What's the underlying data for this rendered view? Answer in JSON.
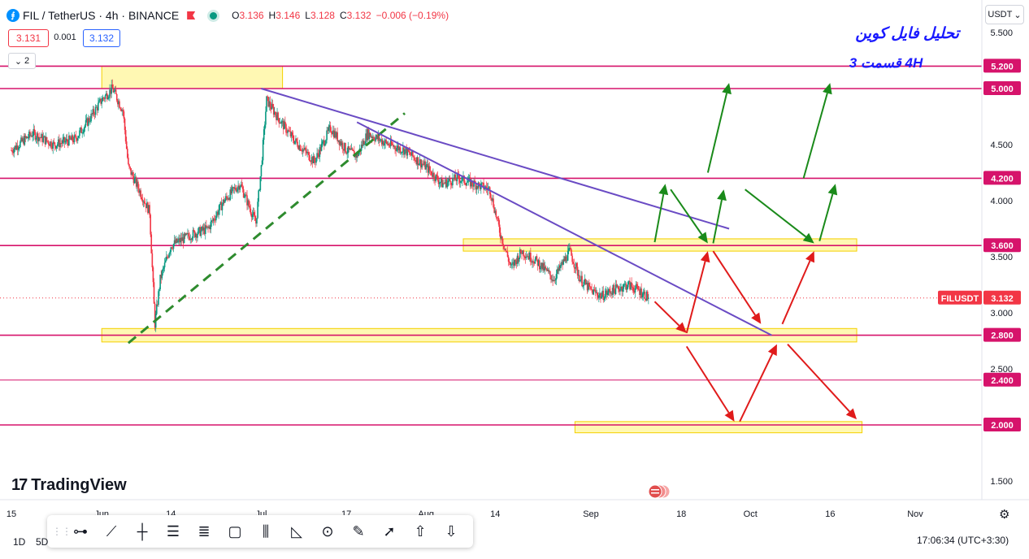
{
  "header": {
    "logo_icon": "filecoin-logo-icon",
    "symbol_text": "FIL / TetherUS · 4h · BINANCE",
    "ohlc": [
      {
        "k": "O",
        "v": "3.136"
      },
      {
        "k": "H",
        "v": "3.146"
      },
      {
        "k": "L",
        "v": "3.128"
      },
      {
        "k": "C",
        "v": "3.132"
      },
      {
        "k": "",
        "v": "−0.006 (−0.19%)"
      }
    ]
  },
  "trade": {
    "sell": "3.131",
    "spread": "0.001",
    "buy": "3.132"
  },
  "indicators_collapsed": "2",
  "currency_selector": "USDT",
  "annotation": {
    "title": "تحلیل فایل کوین",
    "subtitle": "4H    قسمت 3"
  },
  "brand": {
    "name": "TradingView"
  },
  "toolbar": {
    "tools": [
      "horizontal-ray-icon",
      "trend-line-icon",
      "vertical-line-icon",
      "parallel-channel-icon",
      "fib-retracement-icon",
      "rectangle-icon",
      "gann-fan-icon",
      "triangle-pattern-icon",
      "circle-icon",
      "brush-icon",
      "arrow-marker-icon",
      "arrow-up-icon",
      "arrow-down-icon"
    ]
  },
  "footer": {
    "tf1": "1D",
    "tf2": "5D",
    "time": "17:06:34",
    "tz": "(UTC+3:30)"
  },
  "chart_data": {
    "type": "candlestick",
    "pair": "FIL/USDT",
    "timeframe": "4h",
    "y_scale": "linear",
    "ylim": [
      1.3,
      5.65
    ],
    "y_ticks": [
      "5.500",
      "4.500",
      "4.000",
      "3.500",
      "3.000",
      "2.500",
      "1.500"
    ],
    "x_ticks": [
      "15",
      "Jun",
      "14",
      "Jul",
      "17",
      "Aug",
      "14",
      "Sep",
      "18",
      "Oct",
      "16",
      "Nov"
    ],
    "x_dates": [
      "2023-05-15",
      "2023-06-01",
      "2023-06-14",
      "2023-07-01",
      "2023-07-17",
      "2023-08-01",
      "2023-08-14",
      "2023-09-01",
      "2023-09-18",
      "2023-10-01",
      "2023-10-16",
      "2023-11-01"
    ],
    "last_price": {
      "label": "FILUSDT",
      "value": "3.132"
    },
    "horizontal_levels": [
      {
        "label": "5.200",
        "value": 5.2
      },
      {
        "label": "5.000",
        "value": 5.0
      },
      {
        "label": "4.200",
        "value": 4.2
      },
      {
        "label": "3.600",
        "value": 3.6
      },
      {
        "label": "2.800",
        "value": 2.8
      },
      {
        "label": "2.400",
        "value": 2.4
      },
      {
        "label": "2.000",
        "value": 2.0
      }
    ],
    "zones": [
      {
        "from": "2023-06-01",
        "to": "2023-07-05",
        "y1": 5.0,
        "y2": 5.2
      },
      {
        "from": "2023-08-08",
        "to": "2023-10-21",
        "y1": 3.55,
        "y2": 3.66
      },
      {
        "from": "2023-06-01",
        "to": "2023-10-21",
        "y1": 2.74,
        "y2": 2.86
      },
      {
        "from": "2023-08-29",
        "to": "2023-10-22",
        "y1": 1.93,
        "y2": 2.03
      }
    ],
    "trend_lines": [
      {
        "style": "dashed",
        "color": "#2e8b2e",
        "x1": "2023-06-06",
        "y1": 2.73,
        "x2": "2023-07-28",
        "y2": 4.78
      },
      {
        "style": "solid",
        "color": "#6a4bc4",
        "x1": "2023-07-01",
        "y1": 5.0,
        "x2": "2023-09-27",
        "y2": 3.75
      },
      {
        "style": "solid",
        "color": "#6a4bc4",
        "x1": "2023-07-19",
        "y1": 4.7,
        "x2": "2023-10-05",
        "y2": 2.8
      }
    ],
    "scenario_arrows": [
      {
        "color": "#1a8a1a",
        "x1": "2023-09-13",
        "y1": 3.63,
        "x2": "2023-09-15",
        "y2": 4.15
      },
      {
        "color": "#1a8a1a",
        "x1": "2023-09-16",
        "y1": 4.1,
        "x2": "2023-09-23",
        "y2": 3.62
      },
      {
        "color": "#1a8a1a",
        "x1": "2023-09-24",
        "y1": 3.62,
        "x2": "2023-09-26",
        "y2": 4.1
      },
      {
        "color": "#1a8a1a",
        "x1": "2023-09-23",
        "y1": 4.25,
        "x2": "2023-09-27",
        "y2": 5.05
      },
      {
        "color": "#1a8a1a",
        "x1": "2023-09-30",
        "y1": 4.1,
        "x2": "2023-10-13",
        "y2": 3.62
      },
      {
        "color": "#1a8a1a",
        "x1": "2023-10-14",
        "y1": 3.64,
        "x2": "2023-10-17",
        "y2": 4.15
      },
      {
        "color": "#1a8a1a",
        "x1": "2023-10-11",
        "y1": 4.2,
        "x2": "2023-10-16",
        "y2": 5.05
      },
      {
        "color": "#e01b1b",
        "x1": "2023-09-13",
        "y1": 3.1,
        "x2": "2023-09-19",
        "y2": 2.82
      },
      {
        "color": "#e01b1b",
        "x1": "2023-09-19",
        "y1": 2.82,
        "x2": "2023-09-23",
        "y2": 3.55
      },
      {
        "color": "#e01b1b",
        "x1": "2023-09-24",
        "y1": 3.55,
        "x2": "2023-10-03",
        "y2": 2.9
      },
      {
        "color": "#e01b1b",
        "x1": "2023-10-07",
        "y1": 2.9,
        "x2": "2023-10-13",
        "y2": 3.55
      },
      {
        "color": "#e01b1b",
        "x1": "2023-09-19",
        "y1": 2.7,
        "x2": "2023-09-28",
        "y2": 2.03
      },
      {
        "color": "#e01b1b",
        "x1": "2023-09-29",
        "y1": 2.03,
        "x2": "2023-10-06",
        "y2": 2.72
      },
      {
        "color": "#e01b1b",
        "x1": "2023-10-08",
        "y1": 2.72,
        "x2": "2023-10-21",
        "y2": 2.05
      }
    ],
    "price_path": [
      [
        "2023-05-15",
        4.45
      ],
      [
        "2023-05-19",
        4.6
      ],
      [
        "2023-05-23",
        4.5
      ],
      [
        "2023-05-27",
        4.55
      ],
      [
        "2023-05-30",
        4.75
      ],
      [
        "2023-06-01",
        4.9
      ],
      [
        "2023-06-03",
        5.0
      ],
      [
        "2023-06-05",
        4.8
      ],
      [
        "2023-06-06",
        4.3
      ],
      [
        "2023-06-08",
        4.1
      ],
      [
        "2023-06-10",
        3.9
      ],
      [
        "2023-06-11",
        2.9
      ],
      [
        "2023-06-12",
        3.3
      ],
      [
        "2023-06-14",
        3.6
      ],
      [
        "2023-06-18",
        3.7
      ],
      [
        "2023-06-21",
        3.75
      ],
      [
        "2023-06-24",
        4.0
      ],
      [
        "2023-06-27",
        4.15
      ],
      [
        "2023-06-30",
        3.8
      ],
      [
        "2023-07-01",
        4.3
      ],
      [
        "2023-07-02",
        4.9
      ],
      [
        "2023-07-04",
        4.75
      ],
      [
        "2023-07-07",
        4.55
      ],
      [
        "2023-07-11",
        4.35
      ],
      [
        "2023-07-14",
        4.65
      ],
      [
        "2023-07-17",
        4.45
      ],
      [
        "2023-07-19",
        4.4
      ],
      [
        "2023-07-21",
        4.6
      ],
      [
        "2023-07-25",
        4.5
      ],
      [
        "2023-07-28",
        4.45
      ],
      [
        "2023-08-01",
        4.3
      ],
      [
        "2023-08-04",
        4.15
      ],
      [
        "2023-08-07",
        4.2
      ],
      [
        "2023-08-10",
        4.15
      ],
      [
        "2023-08-13",
        4.1
      ],
      [
        "2023-08-14",
        3.9
      ],
      [
        "2023-08-15",
        3.7
      ],
      [
        "2023-08-16",
        3.55
      ],
      [
        "2023-08-17",
        3.4
      ],
      [
        "2023-08-19",
        3.55
      ],
      [
        "2023-08-22",
        3.45
      ],
      [
        "2023-08-25",
        3.3
      ],
      [
        "2023-08-28",
        3.55
      ],
      [
        "2023-08-30",
        3.3
      ],
      [
        "2023-09-01",
        3.2
      ],
      [
        "2023-09-03",
        3.15
      ],
      [
        "2023-09-05",
        3.2
      ],
      [
        "2023-09-08",
        3.25
      ],
      [
        "2023-09-10",
        3.2
      ],
      [
        "2023-09-12",
        3.132
      ]
    ]
  }
}
